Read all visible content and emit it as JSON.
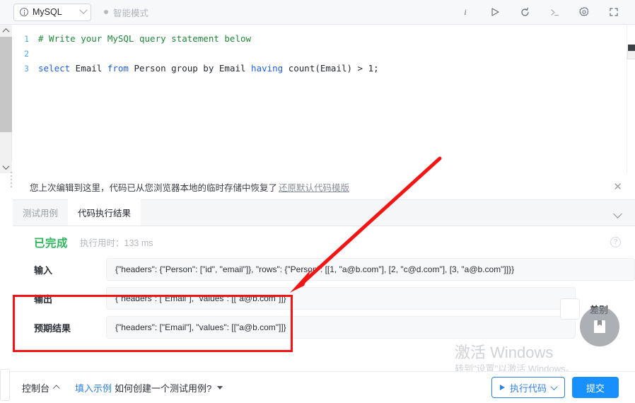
{
  "topbar": {
    "language": "MySQL",
    "language_icon": "info-circle-icon",
    "smart_mode": "智能模式",
    "icons": [
      {
        "name": "info-icon",
        "glyph": "i"
      },
      {
        "name": "run-icon",
        "glyph": "▷"
      },
      {
        "name": "reset-icon",
        "glyph": "↻"
      },
      {
        "name": "console-icon",
        "glyph": ">_"
      },
      {
        "name": "settings-gear-icon",
        "glyph": "⚙"
      },
      {
        "name": "fullscreen-icon",
        "glyph": "⛶"
      }
    ]
  },
  "editor": {
    "lines": [
      {
        "num": "1",
        "text": "# Write your MySQL query statement below"
      },
      {
        "num": "2",
        "text": ""
      },
      {
        "num": "3",
        "text": "select Email from Person group by Email having count(Email) > 1;"
      }
    ],
    "line3": {
      "kw1": "select",
      "id1": " Email ",
      "kw2": "from",
      "id2": " Person group by Email ",
      "kw3": "having",
      "id3": " count(Email) > 1;"
    }
  },
  "notice": {
    "text": "您上次编辑到这里，代码已从您浏览器本地的临时存储中恢复了",
    "link": "还原默认代码模版",
    "close": "✕"
  },
  "tabs": [
    {
      "label": "测试用例",
      "active": false
    },
    {
      "label": "代码执行结果",
      "active": true
    }
  ],
  "result": {
    "status": "已完成",
    "time_label": "执行用时：",
    "time_value": "133 ms",
    "help_glyph": "?",
    "rows": [
      {
        "label": "输入",
        "value": "{\"headers\": {\"Person\": [\"id\", \"email\"]}, \"rows\": {\"Person\": [[1, \"a@b.com\"], [2, \"c@d.com\"], [3, \"a@b.com\"]]}}"
      },
      {
        "label": "输出",
        "value": "{\"headers\": [\"Email\"], \"values\": [[\"a@b.com\"]]}"
      },
      {
        "label": "预期结果",
        "value": "{\"headers\": [\"Email\"], \"values\": [[\"a@b.com\"]]}"
      }
    ],
    "diff_label": "差别",
    "diff_fab_icon": "bookmark-book-icon"
  },
  "watermark": {
    "line1": "激活 Windows",
    "line2": "转到\"设置\"以激活 Windows。"
  },
  "bottombar": {
    "console": "控制台",
    "hint_link": "填入示例",
    "hint_text": "如何创建一个测试用例?",
    "run_label": "执行代码",
    "submit_label": "提交"
  },
  "annotation": {
    "color": "#f51414",
    "shape": "rectangle+arrow"
  }
}
